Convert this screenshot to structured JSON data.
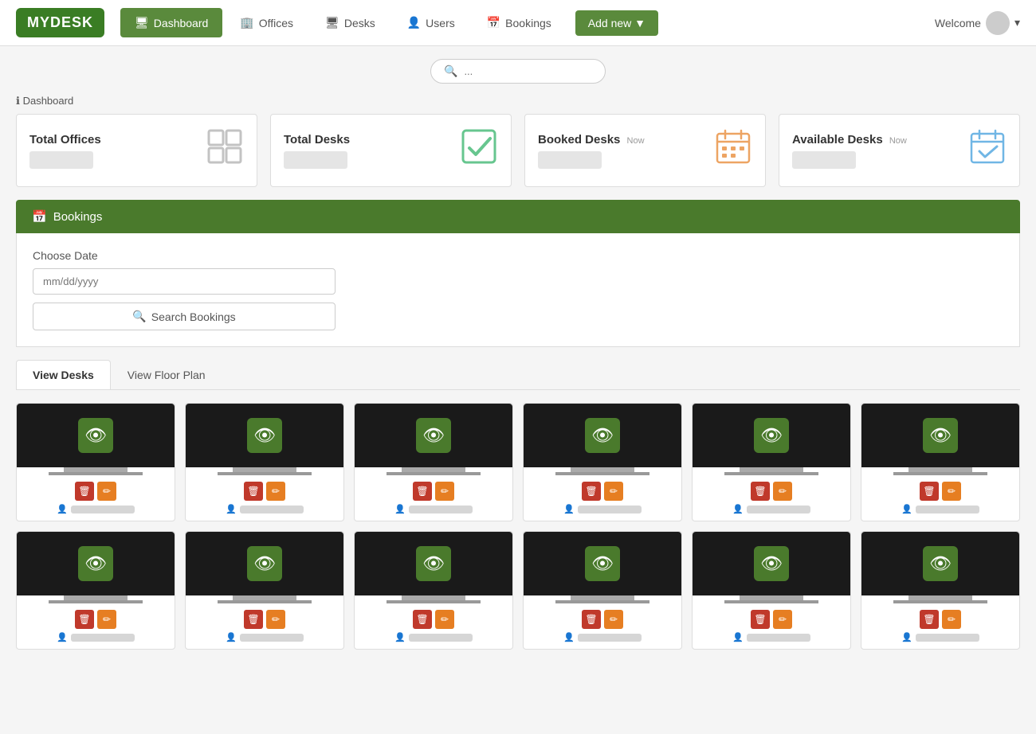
{
  "logo": {
    "text": "MYDESK"
  },
  "nav": {
    "tabs": [
      {
        "id": "dashboard",
        "label": "Dashboard",
        "icon": "🖥",
        "active": true
      },
      {
        "id": "offices",
        "label": "Offices",
        "icon": "🏢",
        "active": false
      },
      {
        "id": "desks",
        "label": "Desks",
        "icon": "🖥",
        "active": false
      },
      {
        "id": "users",
        "label": "Users",
        "icon": "👤",
        "active": false
      },
      {
        "id": "bookings",
        "label": "Bookings",
        "icon": "📅",
        "active": false
      }
    ],
    "add_new_label": "Add new ▼",
    "welcome_label": "Welcome"
  },
  "search": {
    "placeholder": "..."
  },
  "breadcrumb": {
    "icon": "ℹ",
    "label": "Dashboard"
  },
  "stats": [
    {
      "id": "total-offices",
      "title": "Total Offices",
      "now": false,
      "icon": "offices",
      "color": "#888"
    },
    {
      "id": "total-desks",
      "title": "Total Desks",
      "now": false,
      "icon": "check",
      "color": "#27ae60"
    },
    {
      "id": "booked-desks",
      "title": "Booked Desks",
      "now": true,
      "icon": "calendar",
      "color": "#e67e22"
    },
    {
      "id": "available-desks",
      "title": "Available Desks",
      "now": true,
      "icon": "calendar-check",
      "color": "#3498db"
    }
  ],
  "bookings": {
    "header_label": "Bookings",
    "choose_date_label": "Choose Date",
    "date_placeholder": "mm/dd/yyyy",
    "search_btn_label": "Search Bookings"
  },
  "desk_tabs": [
    {
      "id": "view-desks",
      "label": "View Desks",
      "active": true
    },
    {
      "id": "view-floor-plan",
      "label": "View Floor Plan",
      "active": false
    }
  ],
  "desks": [
    {
      "id": 1,
      "user": ""
    },
    {
      "id": 2,
      "user": ""
    },
    {
      "id": 3,
      "user": ""
    },
    {
      "id": 4,
      "user": ""
    },
    {
      "id": 5,
      "user": ""
    },
    {
      "id": 6,
      "user": ""
    },
    {
      "id": 7,
      "user": ""
    },
    {
      "id": 8,
      "user": ""
    },
    {
      "id": 9,
      "user": ""
    },
    {
      "id": 10,
      "user": ""
    },
    {
      "id": 11,
      "user": ""
    },
    {
      "id": 12,
      "user": ""
    }
  ]
}
